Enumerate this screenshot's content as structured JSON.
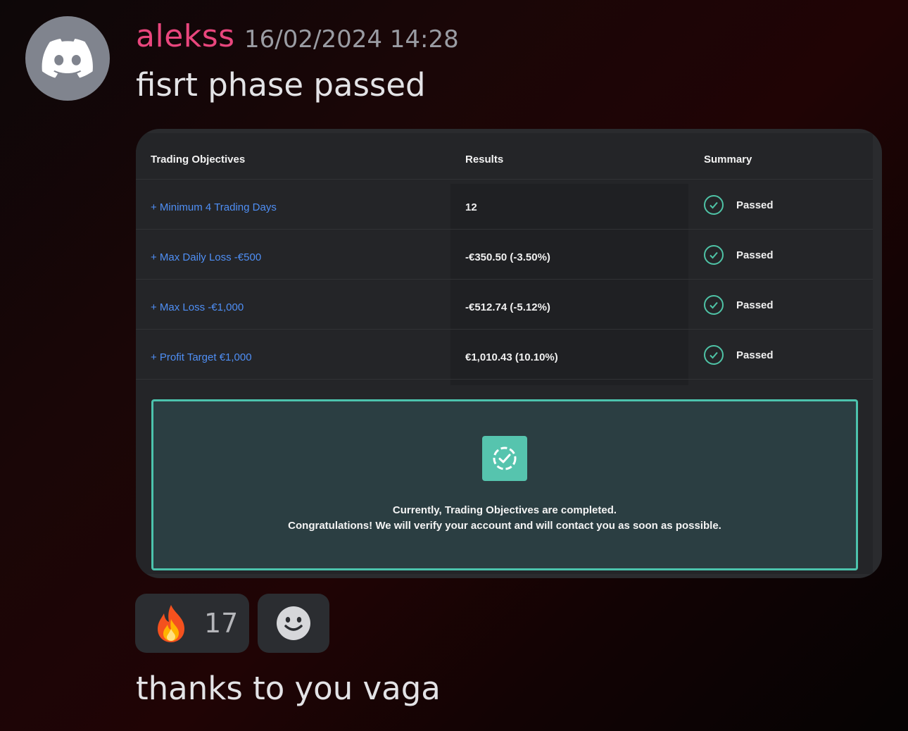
{
  "message1": {
    "username": "alekss",
    "timestamp": "16/02/2024 14:28",
    "text": "fisrt phase passed"
  },
  "table": {
    "headers": [
      "Trading Objectives",
      "Results",
      "Summary"
    ],
    "rows": [
      {
        "objective": "+ Minimum 4 Trading Days",
        "result": "12",
        "summary": "Passed"
      },
      {
        "objective": "+ Max Daily Loss -€500",
        "result": "-€350.50 (-3.50%)",
        "summary": "Passed"
      },
      {
        "objective": "+ Max Loss -€1,000",
        "result": "-€512.74 (-5.12%)",
        "summary": "Passed"
      },
      {
        "objective": "+ Profit Target €1,000",
        "result": "€1,010.43 (10.10%)",
        "summary": "Passed"
      }
    ]
  },
  "banner": {
    "line1": "Currently, Trading Objectives are completed.",
    "line2": "Congratulations! We will verify your account and will contact you as soon as possible."
  },
  "reactions": {
    "fire_emoji": "🔥",
    "fire_count": "17",
    "add_reaction_icon": "smiley-icon"
  },
  "message2": {
    "text": "thanks to you vaga"
  },
  "colors": {
    "username": "#e9467d",
    "link_blue": "#4f8ff5",
    "success_teal": "#4cc3ad"
  }
}
